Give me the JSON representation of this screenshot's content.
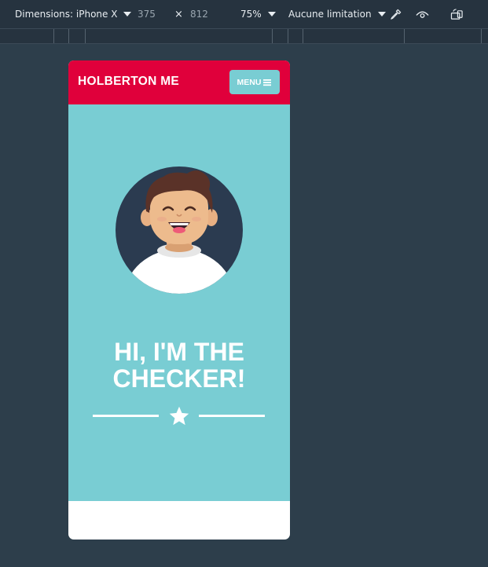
{
  "devtools": {
    "dimensions_label": "Dimensions: iPhone X",
    "width": "375",
    "times": "×",
    "height": "812",
    "zoom": "75%",
    "throttle": "Aucune limitation"
  },
  "nav": {
    "brand": "HOLBERTON ME",
    "menu_label": "MENU"
  },
  "hero": {
    "title_line1": "HI, I'M THE",
    "title_line2": "CHECKER!"
  },
  "colors": {
    "nav_bg": "#e0003b",
    "hero_bg": "#79cdd3",
    "menu_bg": "#79cdd3",
    "page_bg": "#2d3e4b"
  }
}
